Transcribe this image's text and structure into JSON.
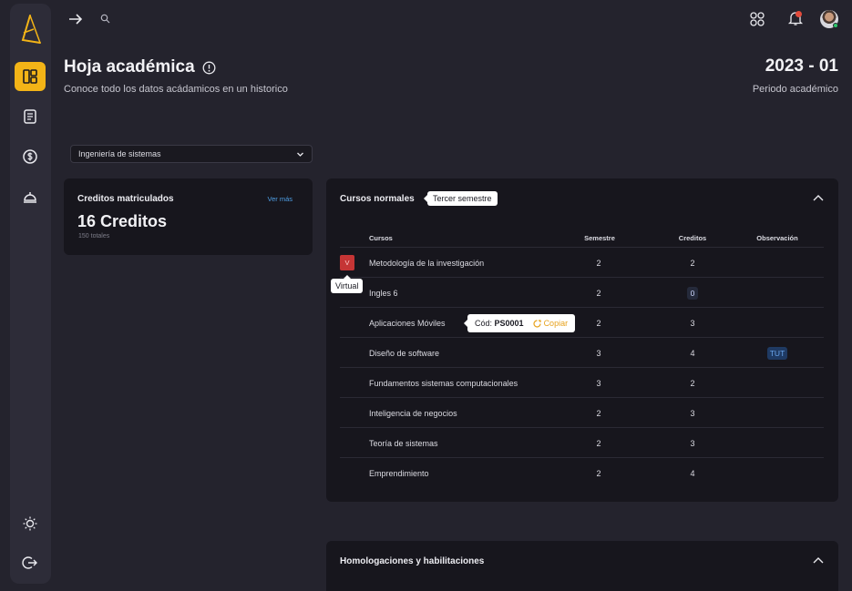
{
  "header": {
    "title": "Hoja académica",
    "subtitle": "Conoce todo los datos acádamicos en un historico",
    "period_value": "2023 - 01",
    "period_label": "Periodo académico"
  },
  "program_select": {
    "selected": "Ingeniería de sistemas"
  },
  "credits": {
    "title": "Creditos matriculados",
    "link": "Ver más",
    "value": "16 Creditos",
    "total": "150 totales"
  },
  "courses": {
    "title": "Cursos normales",
    "semester_badge": "Tercer semestre",
    "columns": [
      "Cursos",
      "Semestre",
      "Creditos",
      "Observación"
    ],
    "rows": [
      {
        "name": "Metodología de la investigación",
        "semester": "2",
        "credits": "2",
        "observation": "",
        "badge": "V"
      },
      {
        "name": "Ingles 6",
        "semester": "2",
        "credits": "0",
        "observation": ""
      },
      {
        "name": "Aplicaciones Móviles",
        "semester": "2",
        "credits": "3",
        "observation": ""
      },
      {
        "name": "Diseño de software",
        "semester": "3",
        "credits": "4",
        "observation": "TUT"
      },
      {
        "name": "Fundamentos sistemas computacionales",
        "semester": "3",
        "credits": "2",
        "observation": ""
      },
      {
        "name": "Inteligencia de negocios",
        "semester": "2",
        "credits": "3",
        "observation": ""
      },
      {
        "name": "Teoría de sistemas",
        "semester": "2",
        "credits": "3",
        "observation": ""
      },
      {
        "name": "Emprendimiento",
        "semester": "2",
        "credits": "4",
        "observation": ""
      }
    ],
    "tooltip_virtual": "Virtual",
    "tooltip_code_label": "Cód:",
    "tooltip_code_value": "PS0001",
    "tooltip_copy": "Copiar"
  },
  "homologations": {
    "title": "Homologaciones y habilitaciones"
  },
  "icons": {
    "logo": "app-logo-icon",
    "nav": [
      "dashboard-icon",
      "document-icon",
      "dollar-icon",
      "dome-icon",
      "sun-icon",
      "logout-icon"
    ],
    "top": [
      "arrow-right-icon",
      "search-icon",
      "apps-grid-icon",
      "bell-icon"
    ]
  },
  "colors": {
    "accent": "#f3b417",
    "background": "#24232d",
    "card": "#17161d",
    "link": "#4f9fe5",
    "danger": "#c53535",
    "copy": "#e7a21d"
  }
}
